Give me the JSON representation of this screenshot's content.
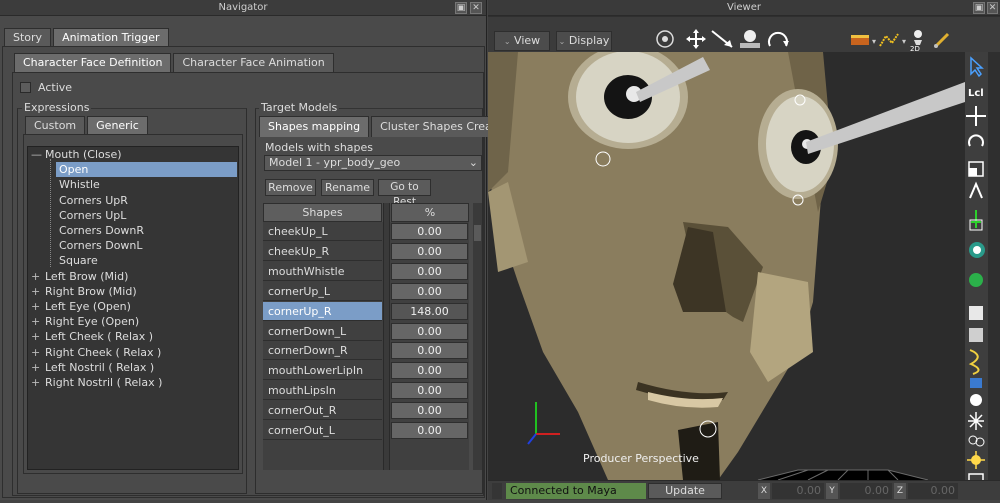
{
  "navigator": {
    "title": "Navigator",
    "top_tabs": [
      "Story",
      "Animation Trigger"
    ],
    "sub_tabs": [
      "Character Face Definition",
      "Character Face Animation"
    ],
    "active_label": "Active",
    "expressions_label": "Expressions",
    "expr_tabs": [
      "Custom",
      "Generic"
    ],
    "tree": [
      {
        "label": "Mouth (Close)",
        "level": 0,
        "expanded": true
      },
      {
        "label": "Open",
        "level": 1,
        "selected": true
      },
      {
        "label": "Whistle",
        "level": 1
      },
      {
        "label": "Corners UpR",
        "level": 1
      },
      {
        "label": "Corners UpL",
        "level": 1
      },
      {
        "label": "Corners DownR",
        "level": 1
      },
      {
        "label": "Corners DownL",
        "level": 1
      },
      {
        "label": "Square",
        "level": 1
      },
      {
        "label": "Left Brow (Mid)",
        "level": 0
      },
      {
        "label": "Right Brow (Mid)",
        "level": 0
      },
      {
        "label": "Left Eye (Open)",
        "level": 0
      },
      {
        "label": "Right Eye (Open)",
        "level": 0
      },
      {
        "label": "Left Cheek ( Relax )",
        "level": 0
      },
      {
        "label": "Right Cheek ( Relax )",
        "level": 0
      },
      {
        "label": "Left Nostril ( Relax )",
        "level": 0
      },
      {
        "label": "Right Nostril ( Relax )",
        "level": 0
      }
    ],
    "target_models_label": "Target Models",
    "target_tabs": [
      "Shapes mapping",
      "Cluster Shapes Creation"
    ],
    "models_with_shapes_label": "Models with shapes",
    "model_select": "Model 1 - ypr_body_geo",
    "buttons": {
      "remove": "Remove",
      "rename": "Rename",
      "go_to_rest": "Go to Rest"
    },
    "grid_headers": {
      "shapes": "Shapes",
      "percent": "%"
    },
    "shapes": [
      {
        "name": "cheekUp_L",
        "value": "0.00"
      },
      {
        "name": "cheekUp_R",
        "value": "0.00"
      },
      {
        "name": "mouthWhistle",
        "value": "0.00"
      },
      {
        "name": "cornerUp_L",
        "value": "0.00"
      },
      {
        "name": "cornerUp_R",
        "value": "148.00",
        "selected": true
      },
      {
        "name": "cornerDown_L",
        "value": "0.00"
      },
      {
        "name": "cornerDown_R",
        "value": "0.00"
      },
      {
        "name": "mouthLowerLipIn",
        "value": "0.00"
      },
      {
        "name": "mouthLipsIn",
        "value": "0.00"
      },
      {
        "name": "cornerOut_R",
        "value": "0.00"
      },
      {
        "name": "cornerOut_L",
        "value": "0.00"
      }
    ]
  },
  "viewer": {
    "title": "Viewer",
    "view_menu": "View",
    "display_menu": "Display",
    "camera_label": "Producer Perspective",
    "twod_label": "2D",
    "status": "Connected to Maya",
    "update_button": "Update",
    "coords": {
      "x_label": "X",
      "x": "0.00",
      "y_label": "Y",
      "y": "0.00",
      "z_label": "Z",
      "z": "0.00"
    },
    "right_toolbar_labels": {
      "lcl": "Lcl"
    }
  }
}
